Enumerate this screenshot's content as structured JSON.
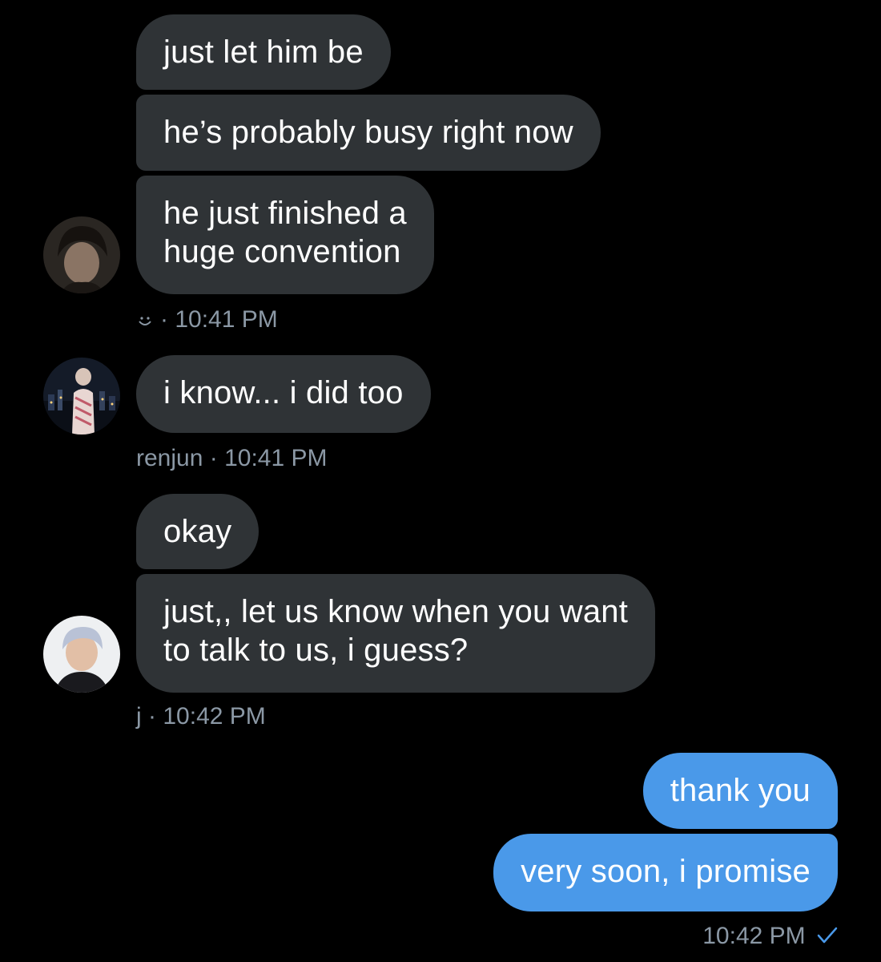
{
  "groups": [
    {
      "messages": [
        "just let him be",
        "he’s probably busy right now",
        "he just finished a\nhuge convention"
      ],
      "meta": {
        "icon": "smiley-icon",
        "separator": "·",
        "time": "10:41 PM"
      },
      "avatar": "avatar-dark-hair"
    },
    {
      "messages": [
        "i know... i did too"
      ],
      "meta": {
        "name": "renjun",
        "separator": "·",
        "time": "10:41 PM"
      },
      "avatar": "avatar-city-night"
    },
    {
      "messages": [
        "okay",
        "just,, let us know when you want\nto talk to us, i guess?"
      ],
      "meta": {
        "name": "j",
        "separator": "·",
        "time": "10:42 PM"
      },
      "avatar": "avatar-silver-hair"
    },
    {
      "outgoing": true,
      "messages": [
        "thank you",
        "very soon, i promise"
      ],
      "meta": {
        "time": "10:42 PM",
        "status_icon": "checkmark-icon"
      }
    }
  ],
  "colors": {
    "background": "#000000",
    "incoming_bubble": "#2f3336",
    "outgoing_bubble": "#4a99e9",
    "meta_text": "#8b98a5",
    "read_check": "#4a99e9"
  }
}
